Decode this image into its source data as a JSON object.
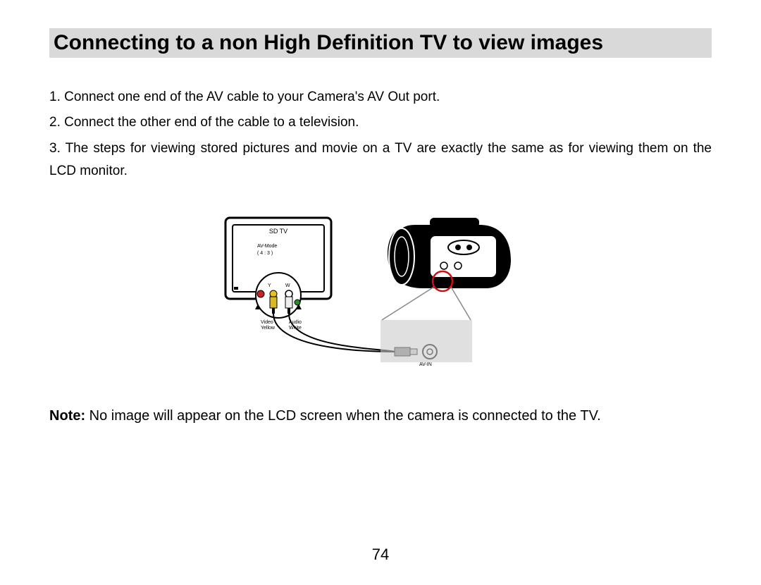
{
  "title": "Connecting to a non High Definition TV to view images",
  "steps": [
    "1. Connect one end of the AV cable to your Camera's AV Out port.",
    "2. Connect the other end of the cable to a television.",
    "3. The steps for viewing stored pictures and movie on a TV are exactly the same as for viewing them on the LCD monitor."
  ],
  "diagram": {
    "tv_label": "SD TV",
    "mode_label_1": "AV-Mode",
    "mode_label_2": "( 4 : 3 )",
    "y_label": "Y",
    "w_label": "W",
    "video_label_1": "Video",
    "video_label_2": "Yellow",
    "audio_label_1": "Audio",
    "audio_label_2": "White",
    "avin_label": "AV-IN"
  },
  "note_label": "Note:",
  "note_text": "  No image will appear on the LCD screen when the camera is connected to the TV.",
  "page_number": "74"
}
